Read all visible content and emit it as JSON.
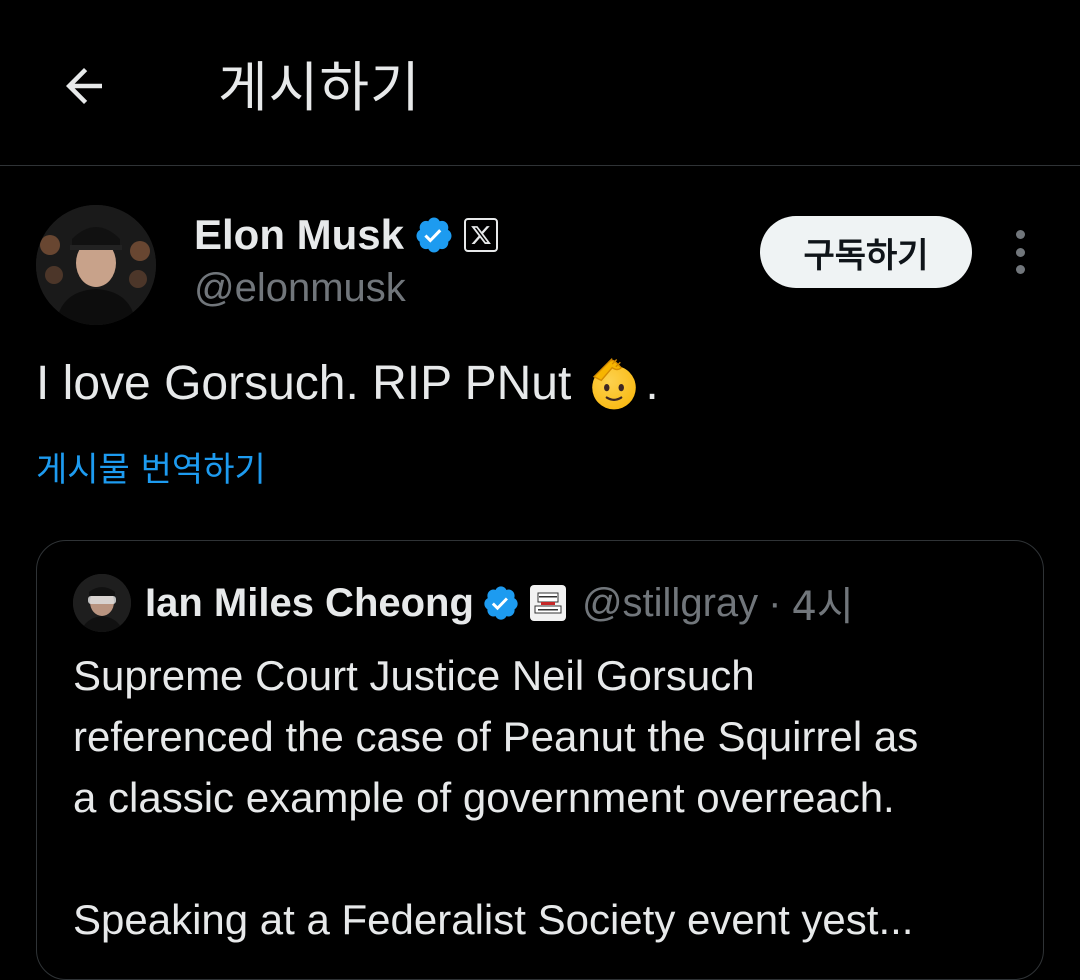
{
  "header": {
    "back_icon": "arrow-left-icon",
    "title": "게시하기"
  },
  "post": {
    "author": {
      "display_name": "Elon Musk",
      "handle": "@elonmusk",
      "verified_icon": "verified-badge-icon",
      "affiliation_icon": "x-logo-icon"
    },
    "subscribe_label": "구독하기",
    "more_icon": "more-vertical-icon",
    "text_before_emoji": "I love Gorsuch. RIP PNut",
    "emoji": "saluting-face-emoji",
    "text_after_emoji": ".",
    "translate_label": "게시물 번역하기"
  },
  "quoted_post": {
    "author": {
      "display_name": "Ian Miles Cheong",
      "handle": "@stillgray",
      "verified_icon": "verified-badge-icon",
      "affiliation_icon": "road-to-election-logo-icon",
      "affiliation_logo_text": "ROAD TO ELECTION"
    },
    "separator": "·",
    "time": "4시",
    "text_lines": [
      "Supreme Court Justice Neil Gorsuch",
      "referenced the case of Peanut the Squirrel as",
      "a classic example of government overreach."
    ],
    "text_truncated": "Speaking at a Federalist Society event yest..."
  },
  "colors": {
    "background": "#000000",
    "text_primary": "#e7e9ea",
    "text_secondary": "#71767b",
    "accent_blue": "#1d9bf0",
    "divider": "#2f3336",
    "button_bg": "#eff3f4"
  }
}
